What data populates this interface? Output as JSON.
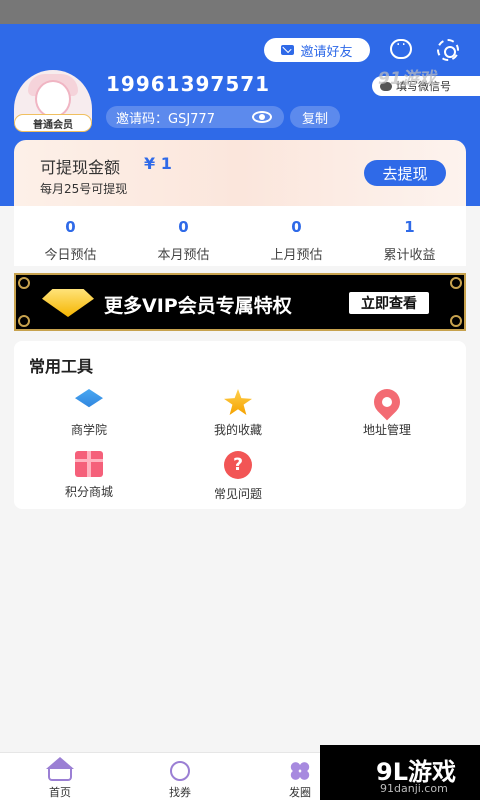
{
  "colors": {
    "accent": "#2f6ae8",
    "header_bg": "#2f6ae8",
    "vip_gold": "#c7a24e",
    "tab_icon": "#9b7fd4"
  },
  "header": {
    "invite_label": "邀请好友",
    "phone": "19961397571",
    "member_level": "普通会员",
    "wechat_label": "填写微信号",
    "invite_code": "邀请码：GSJ777",
    "copy_label": "复制"
  },
  "withdraw": {
    "label": "可提现金额",
    "amount": "¥ 1",
    "note": "每月25号可提现",
    "button": "去提现"
  },
  "stats": [
    {
      "value": "0",
      "label": "今日预估"
    },
    {
      "value": "0",
      "label": "本月预估"
    },
    {
      "value": "0",
      "label": "上月预估"
    },
    {
      "value": "1",
      "label": "累计收益"
    }
  ],
  "vip_banner": {
    "text": "更多VIP会员专属特权",
    "button": "立即查看"
  },
  "tools": {
    "title": "常用工具",
    "items": [
      {
        "label": "商学院",
        "icon": "graduation-cap-icon"
      },
      {
        "label": "我的收藏",
        "icon": "star-icon"
      },
      {
        "label": "地址管理",
        "icon": "location-pin-icon"
      },
      {
        "label": "积分商城",
        "icon": "gift-icon"
      },
      {
        "label": "常见问题",
        "icon": "help-icon"
      }
    ]
  },
  "tabbar": [
    {
      "label": "首页",
      "icon": "home-icon"
    },
    {
      "label": "找券",
      "icon": "coupon-search-icon"
    },
    {
      "label": "发圈",
      "icon": "share-circle-icon"
    }
  ],
  "watermark": {
    "top": "91游戏",
    "brand": "9L游戏",
    "url": "91danji.com"
  }
}
